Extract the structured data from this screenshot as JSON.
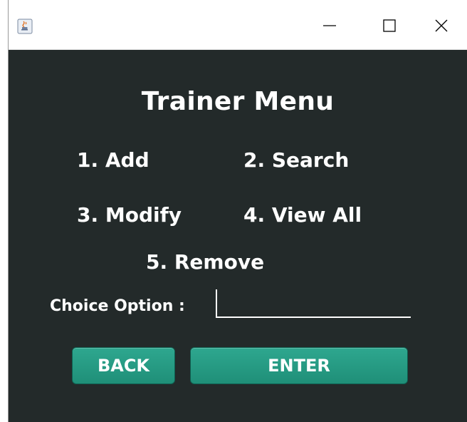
{
  "window": {
    "controls": {
      "minimize_icon": "minimize-icon",
      "maximize_icon": "maximize-icon",
      "close_icon": "close-icon"
    },
    "app_icon": "java-cup-icon"
  },
  "menu": {
    "title": "Trainer Menu",
    "options": [
      "1. Add",
      "2. Search",
      "3. Modify",
      "4. View All",
      "5. Remove"
    ]
  },
  "form": {
    "choice_label": "Choice Option :",
    "choice_value": ""
  },
  "buttons": {
    "back_label": "BACK",
    "enter_label": "ENTER"
  },
  "colors": {
    "background": "#232a2a",
    "accent": "#239c84",
    "text": "#ffffff"
  }
}
